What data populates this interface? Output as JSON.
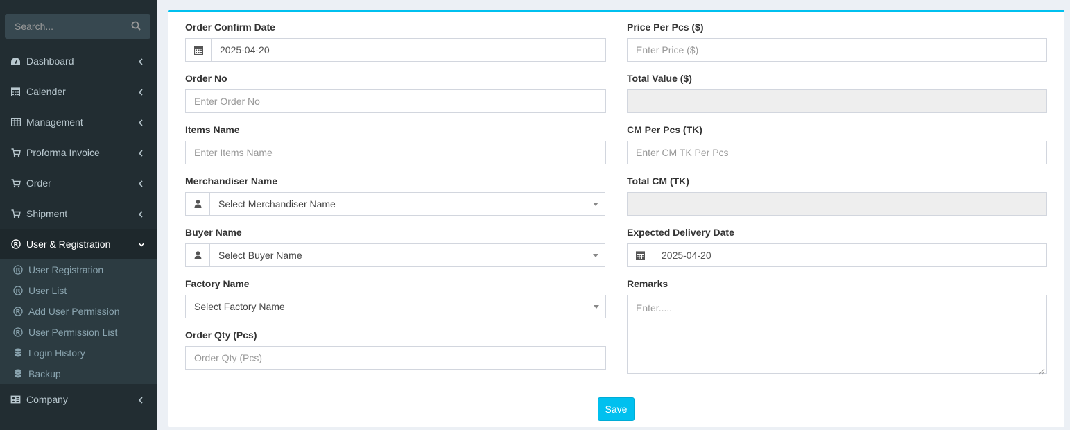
{
  "sidebar": {
    "search_placeholder": "Search...",
    "menu": [
      {
        "label": "Dashboard",
        "icon": "dashboard-icon"
      },
      {
        "label": "Calender",
        "icon": "calendar-icon"
      },
      {
        "label": "Management",
        "icon": "table-icon"
      },
      {
        "label": "Proforma Invoice",
        "icon": "cart-icon"
      },
      {
        "label": "Order",
        "icon": "cart-icon"
      },
      {
        "label": "Shipment",
        "icon": "cart-icon"
      },
      {
        "label": "User & Registration",
        "icon": "registered-icon",
        "active": true
      }
    ],
    "submenu": [
      {
        "label": "User Registration",
        "icon": "registered-icon"
      },
      {
        "label": "User List",
        "icon": "registered-icon"
      },
      {
        "label": "Add User Permission",
        "icon": "registered-icon"
      },
      {
        "label": "User Permission List",
        "icon": "registered-icon"
      },
      {
        "label": "Login History",
        "icon": "database-icon"
      },
      {
        "label": "Backup",
        "icon": "database-icon"
      }
    ],
    "after": [
      {
        "label": "Company",
        "icon": "id-card-icon"
      }
    ]
  },
  "form": {
    "order_confirm_date": {
      "label": "Order Confirm Date",
      "value": "2025-04-20"
    },
    "order_no": {
      "label": "Order No",
      "placeholder": "Enter Order No"
    },
    "items_name": {
      "label": "Items Name",
      "placeholder": "Enter Items Name"
    },
    "merchandiser_name": {
      "label": "Merchandiser Name",
      "selected": "Select Merchandiser Name"
    },
    "buyer_name": {
      "label": "Buyer Name",
      "selected": "Select Buyer Name"
    },
    "factory_name": {
      "label": "Factory Name",
      "selected": "Select Factory Name"
    },
    "order_qty": {
      "label": "Order Qty (Pcs)",
      "placeholder": "Order Qty (Pcs)"
    },
    "price_per_pcs": {
      "label": "Price Per Pcs ($)",
      "placeholder": "Enter Price ($)"
    },
    "total_value": {
      "label": "Total Value ($)",
      "value": ""
    },
    "cm_per_pcs": {
      "label": "CM Per Pcs (TK)",
      "placeholder": "Enter CM TK Per Pcs"
    },
    "total_cm": {
      "label": "Total CM (TK)",
      "value": ""
    },
    "expected_delivery_date": {
      "label": "Expected Delivery Date",
      "value": "2025-04-20"
    },
    "remarks": {
      "label": "Remarks",
      "placeholder": "Enter....."
    },
    "save_label": "Save"
  },
  "colors": {
    "sidebar_bg": "#222d32",
    "accent": "#00c0ef"
  }
}
